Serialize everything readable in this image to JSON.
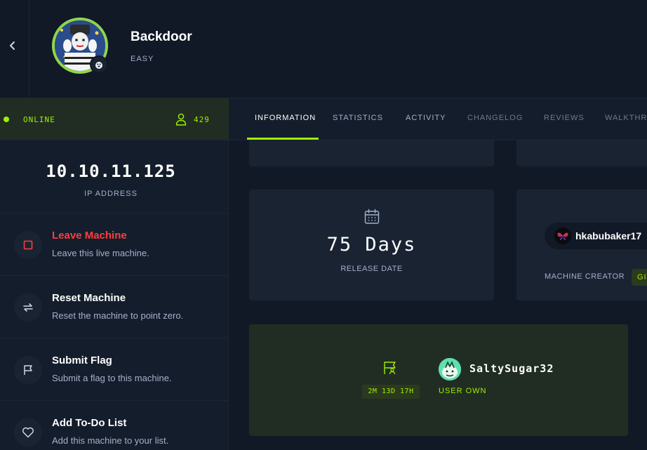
{
  "machine": {
    "name": "Backdoor",
    "difficulty": "EASY"
  },
  "status": {
    "text": "ONLINE",
    "users": "429"
  },
  "ip": {
    "value": "10.10.11.125",
    "label": "IP ADDRESS"
  },
  "actions": [
    {
      "title": "Leave Machine",
      "desc": "Leave this live machine."
    },
    {
      "title": "Reset Machine",
      "desc": "Reset the machine to point zero."
    },
    {
      "title": "Submit Flag",
      "desc": "Submit a flag to this machine."
    },
    {
      "title": "Add To-Do List",
      "desc": "Add this machine to your list."
    }
  ],
  "tabs": [
    {
      "label": "INFORMATION"
    },
    {
      "label": "STATISTICS"
    },
    {
      "label": "ACTIVITY"
    },
    {
      "label": "CHANGELOG"
    },
    {
      "label": "REVIEWS"
    },
    {
      "label": "WALKTHRO"
    }
  ],
  "release": {
    "value": "75 Days",
    "label": "RELEASE DATE"
  },
  "creator": {
    "name": "hkabubaker17",
    "label": "MACHINE CREATOR",
    "gift": "GIV"
  },
  "first_blood": {
    "time": "2M 13D 17H",
    "user": "SaltySugar32",
    "label": "USER OWN"
  },
  "colors": {
    "accent": "#9fef00",
    "danger": "#ff3e3e",
    "background": "#111927",
    "panel": "#1a2332"
  }
}
